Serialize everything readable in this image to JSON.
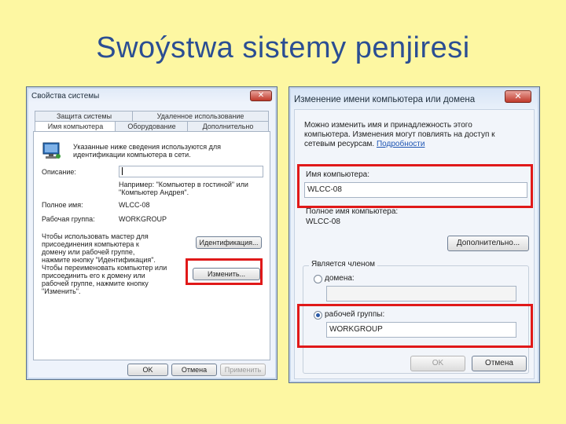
{
  "slide": {
    "title": "Swoýstwa sistemy penjiresi"
  },
  "left_window": {
    "title": "Свойства системы",
    "close": "✕",
    "tabs_row1": [
      "Защита системы",
      "Удаленное использование"
    ],
    "tabs_row2": [
      "Имя компьютера",
      "Оборудование",
      "Дополнительно"
    ],
    "intro": "Указанные ниже сведения используются для идентификации компьютера в сети.",
    "description_label": "Описание:",
    "description_value": "",
    "example": "Например: \"Компьютер в гостиной\" или \"Компьютер Андрея\".",
    "fullname_label": "Полное имя:",
    "fullname_value": "WLCC-08",
    "workgroup_label": "Рабочая группа:",
    "workgroup_value": "WORKGROUP",
    "wizard_text": "Чтобы использовать мастер для присоединения компьютера к домену или рабочей группе, нажмите кнопку \"Идентификация\".",
    "id_button": "Идентификация...",
    "rename_text": "Чтобы переименовать компьютер или присоединить его к домену или рабочей группе, нажмите кнопку \"Изменить\".",
    "change_button": "Изменить...",
    "ok": "OK",
    "cancel": "Отмена",
    "apply": "Применить"
  },
  "right_window": {
    "title": "Изменение имени компьютера или домена",
    "close": "✕",
    "intro": "Можно изменить имя и принадлежность этого компьютера. Изменения могут повлиять на доступ к сетевым ресурсам.",
    "details_link": "Подробности",
    "name_label": "Имя компьютера:",
    "name_value": "WLCC-08",
    "fullname_label": "Полное имя компьютера:",
    "fullname_value": "WLCC-08",
    "more_button": "Дополнительно...",
    "member_label": "Является членом",
    "domain_label": "домена:",
    "domain_value": "",
    "workgroup_label": "рабочей группы:",
    "workgroup_value": "WORKGROUP",
    "ok": "OK",
    "cancel": "Отмена"
  },
  "colors": {
    "highlight": "#e01919",
    "title": "#2b4e93",
    "background": "#fdf7a2"
  }
}
